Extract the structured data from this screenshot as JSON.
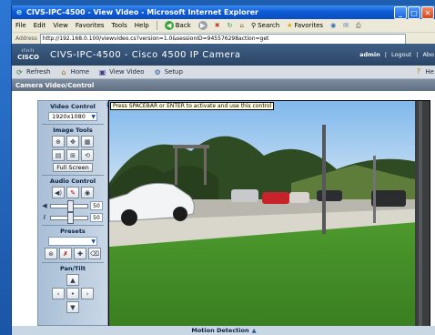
{
  "window": {
    "title": "CIVS-IPC-4500 - View Video - Microsoft Internet Explorer",
    "controls": [
      "_",
      "□",
      "✕"
    ]
  },
  "menu": {
    "items": [
      "File",
      "Edit",
      "View",
      "Favorites",
      "Tools",
      "Help"
    ],
    "back_label": "Back",
    "search_label": "Search",
    "favorites_label": "Favorites"
  },
  "address": {
    "label": "Address",
    "url": "http://192.168.0.100/viewvideo.cs?version=1.0&sessionID=945576298action=get"
  },
  "app": {
    "brand": "CISCO",
    "title": "CIVS-IPC-4500 - Cisco 4500 IP Camera",
    "user": "admin",
    "logout": "Logout",
    "about": "Abo"
  },
  "nav": {
    "refresh": "Refresh",
    "home": "Home",
    "view_video": "View Video",
    "setup": "Setup",
    "help": "He"
  },
  "section_title": "Camera Video/Control",
  "panel": {
    "video_control": "Video Control",
    "resolution": "1920x1080",
    "image_tools": "Image Tools",
    "full_screen": "Full Screen",
    "audio_control": "Audio Control",
    "speaker_volume": "50",
    "mic_volume": "50",
    "presets": "Presets",
    "pan_tilt": "Pan/Tilt"
  },
  "tooltip": "Press SPACEBAR or ENTER to activate and use this control",
  "motion_detection": "Motion Detection",
  "colors": {
    "title_bar": "#0d5bd6",
    "cam_header": "#2a4566",
    "section_bar": "#5d6d80",
    "panel": "#b9cce0"
  }
}
